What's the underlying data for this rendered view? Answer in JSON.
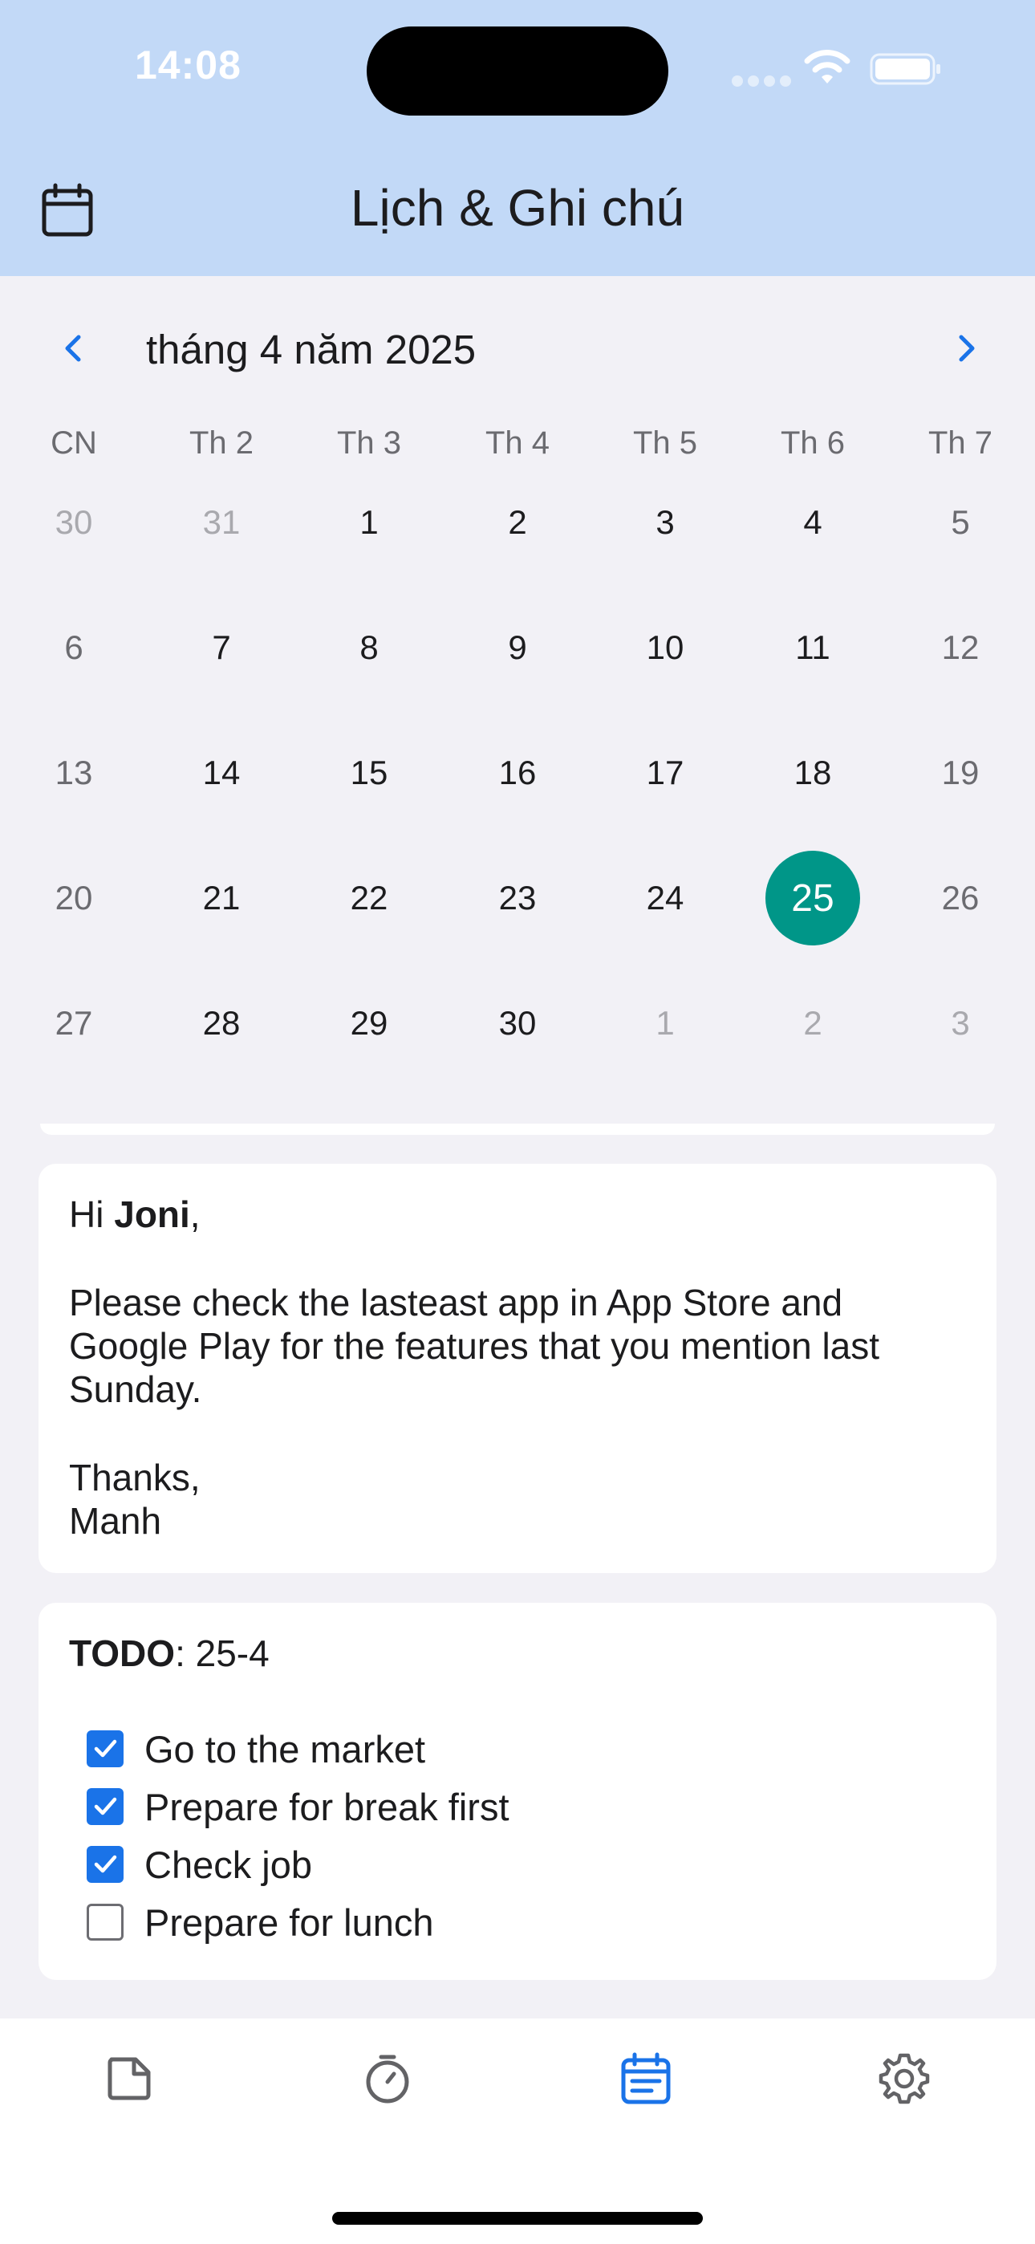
{
  "status_bar": {
    "time": "14:08"
  },
  "header": {
    "title": "Lịch & Ghi chú",
    "icon": "calendar-icon"
  },
  "calendar": {
    "month_label": "tháng 4 năm 2025",
    "weekdays": [
      "CN",
      "Th 2",
      "Th 3",
      "Th 4",
      "Th 5",
      "Th 6",
      "Th 7"
    ],
    "weeks": [
      [
        "30",
        "31",
        "1",
        "2",
        "3",
        "4",
        "5"
      ],
      [
        "6",
        "7",
        "8",
        "9",
        "10",
        "11",
        "12"
      ],
      [
        "13",
        "14",
        "15",
        "16",
        "17",
        "18",
        "19"
      ],
      [
        "20",
        "21",
        "22",
        "23",
        "24",
        "25",
        "26"
      ],
      [
        "27",
        "28",
        "29",
        "30",
        "1",
        "2",
        "3"
      ]
    ],
    "selected_day": "25",
    "selected_color": "#009688"
  },
  "note": {
    "greeting_prefix": "Hi ",
    "greeting_name": "Joni",
    "greeting_suffix": ",",
    "body": "Please check the lasteast app in App Store and Google Play for the features that you mention last Sunday.",
    "closing": "Thanks,",
    "signature": "Manh"
  },
  "todo": {
    "title_bold": "TODO",
    "title_rest": ": 25-4",
    "items": [
      {
        "label": "Go to the market",
        "checked": true
      },
      {
        "label": "Prepare for break first",
        "checked": true
      },
      {
        "label": "Check job",
        "checked": true
      },
      {
        "label": "Prepare for lunch",
        "checked": false
      }
    ]
  },
  "tabbar": {
    "tabs": [
      {
        "icon": "note-icon",
        "active": false
      },
      {
        "icon": "timer-icon",
        "active": false
      },
      {
        "icon": "calendar-icon",
        "active": true
      },
      {
        "icon": "gear-icon",
        "active": false
      }
    ],
    "active_color": "#1a73e8"
  }
}
